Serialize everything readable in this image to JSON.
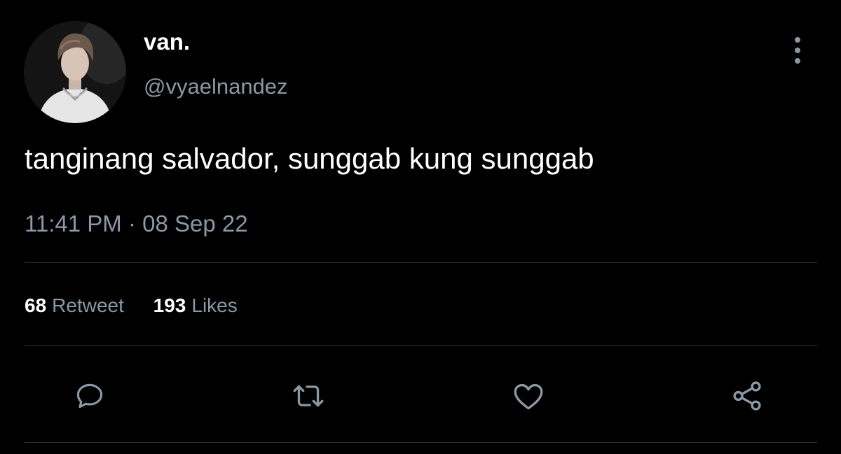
{
  "user": {
    "display_name": "van.",
    "handle": "@vyaelnandez"
  },
  "tweet": {
    "text": "tanginang salvador, sunggab kung sunggab",
    "timestamp": "11:41 PM · 08 Sep 22"
  },
  "stats": {
    "retweets_count": "68",
    "retweets_label": "Retweet",
    "likes_count": "193",
    "likes_label": "Likes"
  },
  "actions": {
    "reply_icon": "speech-bubble-icon",
    "retweet_icon": "retweet-arrows-icon",
    "like_icon": "heart-icon",
    "share_icon": "share-nodes-icon"
  },
  "colors": {
    "background": "#000000",
    "primary_text": "#ffffff",
    "secondary_text": "#8b98a5",
    "divider": "#2f3336"
  }
}
